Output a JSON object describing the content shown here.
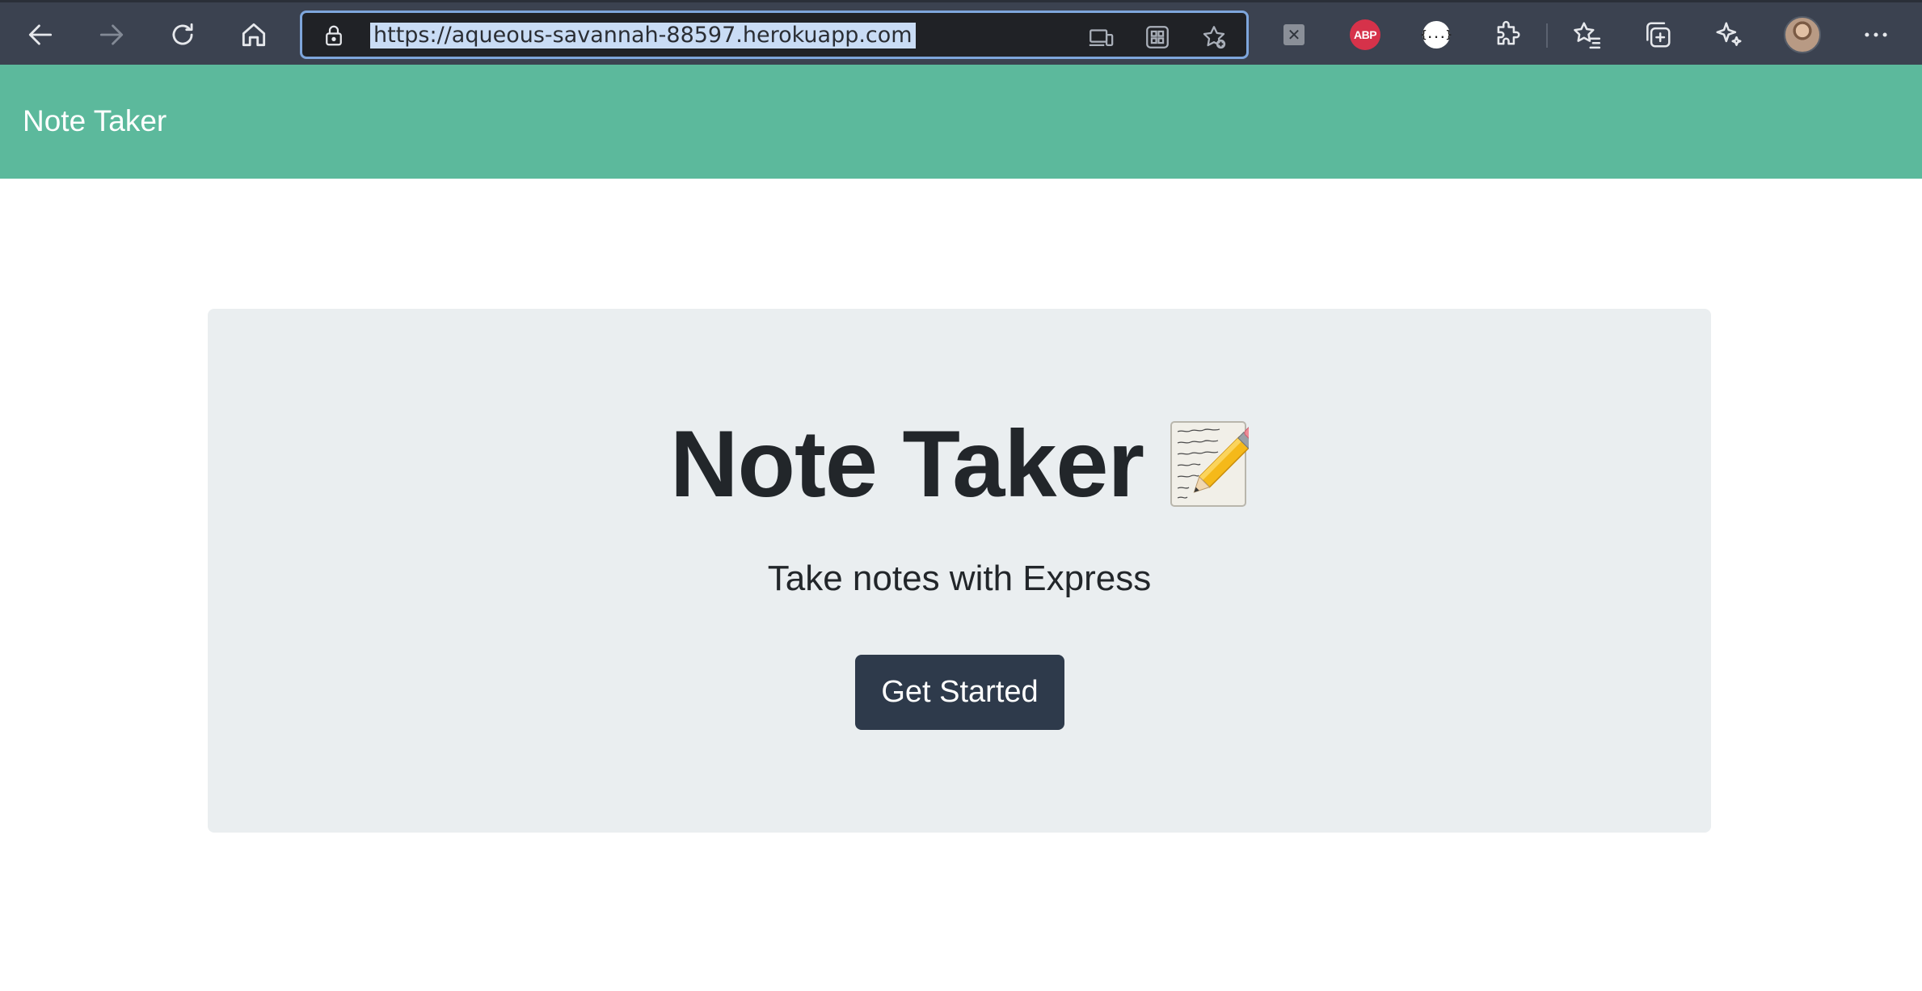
{
  "browser": {
    "url": "https://aqueous-savannah-88597.herokuapp.com",
    "extensions": {
      "adblock_label": "ABP",
      "json_label": "{...}",
      "x_label": "✕"
    },
    "more_label": "···",
    "icons": [
      "back-icon",
      "forward-icon",
      "refresh-icon",
      "home-icon",
      "lock-icon",
      "devices-icon",
      "apps-icon",
      "add-favorite-icon",
      "extensions-icon",
      "favorites-icon",
      "collections-icon",
      "copilot-icon",
      "more-icon"
    ],
    "accent_color": "#7ea6dc"
  },
  "app": {
    "brand": "Note Taker",
    "navbar_color": "#5cb99c"
  },
  "hero": {
    "title": "Note Taker",
    "subtitle": "Take notes with Express",
    "button_label": "Get Started",
    "button_color": "#2e3a4b",
    "emoji_icon": "memo-icon"
  }
}
